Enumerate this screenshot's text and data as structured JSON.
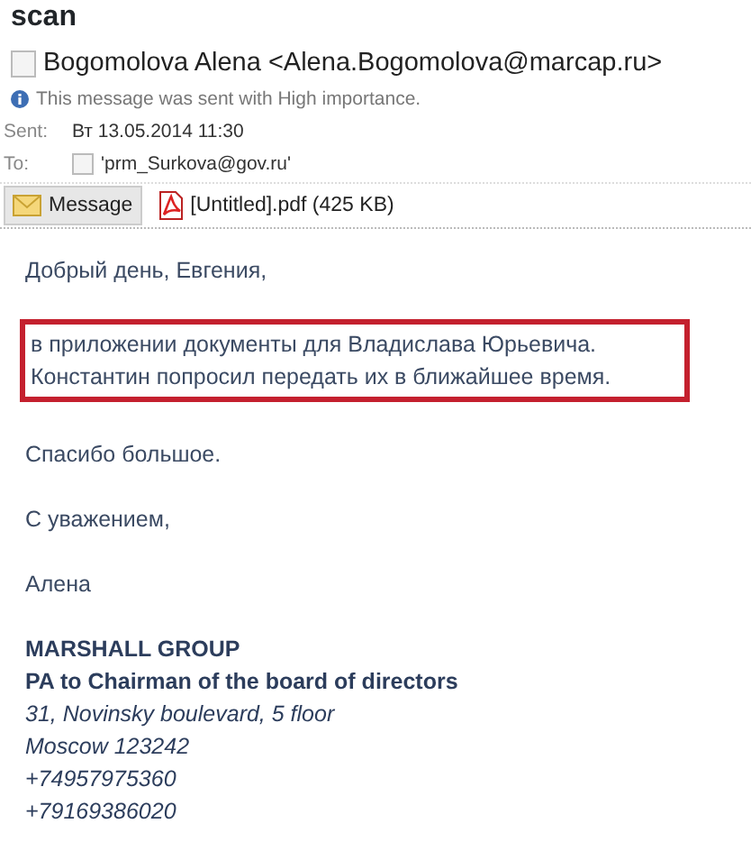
{
  "subject": "scan",
  "sender": "Bogomolova Alena <Alena.Bogomolova@marcap.ru>",
  "info_bar": "This message was sent with High importance.",
  "fields": [
    {
      "label": "Sent:",
      "value": "Вт 13.05.2014 11:30",
      "kind": "text"
    },
    {
      "label": "To:",
      "value": "'prm_Surkova@gov.ru'",
      "kind": "contact"
    }
  ],
  "attachments": [
    {
      "label": "Message",
      "kind": "message",
      "selected": true
    },
    {
      "label": "[Untitled].pdf (425 KB)",
      "kind": "pdf",
      "selected": false
    }
  ],
  "body": [
    {
      "text": "Добрый день, Евгения,",
      "kind": "plain"
    },
    {
      "text": "в приложении документы для Владислава Юрьевича.",
      "kind": "highlighted"
    },
    {
      "text": "Константин попросил передать их в ближайшее время.",
      "kind": "highlighted"
    },
    {
      "text": "Спасибо большое.",
      "kind": "plain"
    },
    {
      "text": "С уважением,",
      "kind": "plain"
    },
    {
      "text": "Алена",
      "kind": "plain"
    }
  ],
  "signature": [
    {
      "text": "MARSHALL GROUP",
      "kind": "heading"
    },
    {
      "text": "PA to Chairman of the board of directors",
      "kind": "heading"
    },
    {
      "text": "31, Novinsky boulevard, 5 floor",
      "kind": "detail"
    },
    {
      "text": "Moscow 123242",
      "kind": "detail"
    },
    {
      "text": "+74957975360",
      "kind": "detail"
    },
    {
      "text": "+79169386020",
      "kind": "detail"
    }
  ]
}
